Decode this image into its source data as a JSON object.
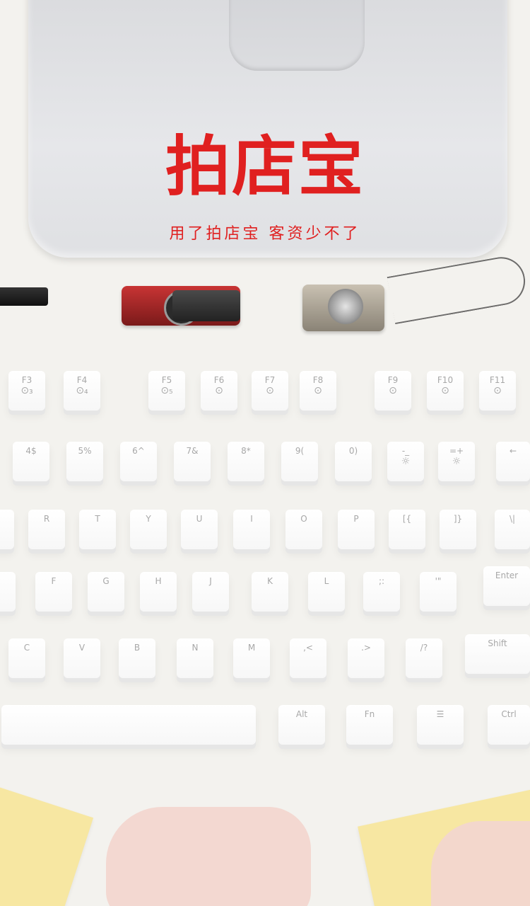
{
  "brand": {
    "logo_text": "拍店宝",
    "slogan": "用了拍店宝  客资少不了",
    "color": "#e02020"
  },
  "keyboard": {
    "row1": [
      {
        "label": "F3",
        "sym": "⊙₃"
      },
      {
        "label": "F4",
        "sym": "⊙₄"
      },
      {
        "label": "F5",
        "sym": "⊙₅"
      },
      {
        "label": "F6",
        "sym": "⊙"
      },
      {
        "label": "F7",
        "sym": "⊙"
      },
      {
        "label": "F8",
        "sym": "⊙"
      },
      {
        "label": "F9",
        "sym": "⊙"
      },
      {
        "label": "F10",
        "sym": "⊙"
      },
      {
        "label": "F11",
        "sym": "⊙"
      }
    ],
    "row2": [
      {
        "label": "4$",
        "sym": ""
      },
      {
        "label": "5%",
        "sym": ""
      },
      {
        "label": "6^",
        "sym": ""
      },
      {
        "label": "7&",
        "sym": ""
      },
      {
        "label": "8*",
        "sym": ""
      },
      {
        "label": "9(",
        "sym": ""
      },
      {
        "label": "0)",
        "sym": ""
      },
      {
        "label": "-_",
        "sym": "☼"
      },
      {
        "label": "=+",
        "sym": "☼"
      },
      {
        "label": "←",
        "sym": ""
      }
    ],
    "row3": [
      {
        "label": "R",
        "sym": ""
      },
      {
        "label": "T",
        "sym": ""
      },
      {
        "label": "Y",
        "sym": ""
      },
      {
        "label": "U",
        "sym": ""
      },
      {
        "label": "I",
        "sym": ""
      },
      {
        "label": "O",
        "sym": ""
      },
      {
        "label": "P",
        "sym": ""
      },
      {
        "label": "[{",
        "sym": ""
      },
      {
        "label": "]}",
        "sym": ""
      },
      {
        "label": "\\|",
        "sym": ""
      }
    ],
    "row4": [
      {
        "label": "F",
        "sym": ""
      },
      {
        "label": "G",
        "sym": ""
      },
      {
        "label": "H",
        "sym": ""
      },
      {
        "label": "J",
        "sym": ""
      },
      {
        "label": "K",
        "sym": ""
      },
      {
        "label": "L",
        "sym": ""
      },
      {
        "label": ";:",
        "sym": ""
      },
      {
        "label": "'\"",
        "sym": ""
      },
      {
        "label": "Enter",
        "sym": ""
      }
    ],
    "row5": [
      {
        "label": "C",
        "sym": ""
      },
      {
        "label": "V",
        "sym": ""
      },
      {
        "label": "B",
        "sym": ""
      },
      {
        "label": "N",
        "sym": ""
      },
      {
        "label": "M",
        "sym": ""
      },
      {
        "label": ",<",
        "sym": ""
      },
      {
        "label": ".>",
        "sym": ""
      },
      {
        "label": "/?",
        "sym": ""
      },
      {
        "label": "Shift",
        "sym": ""
      }
    ],
    "row6": [
      {
        "label": "Alt",
        "sym": ""
      },
      {
        "label": "Fn",
        "sym": ""
      },
      {
        "label": "☰",
        "sym": ""
      },
      {
        "label": "Ctrl",
        "sym": ""
      }
    ]
  }
}
